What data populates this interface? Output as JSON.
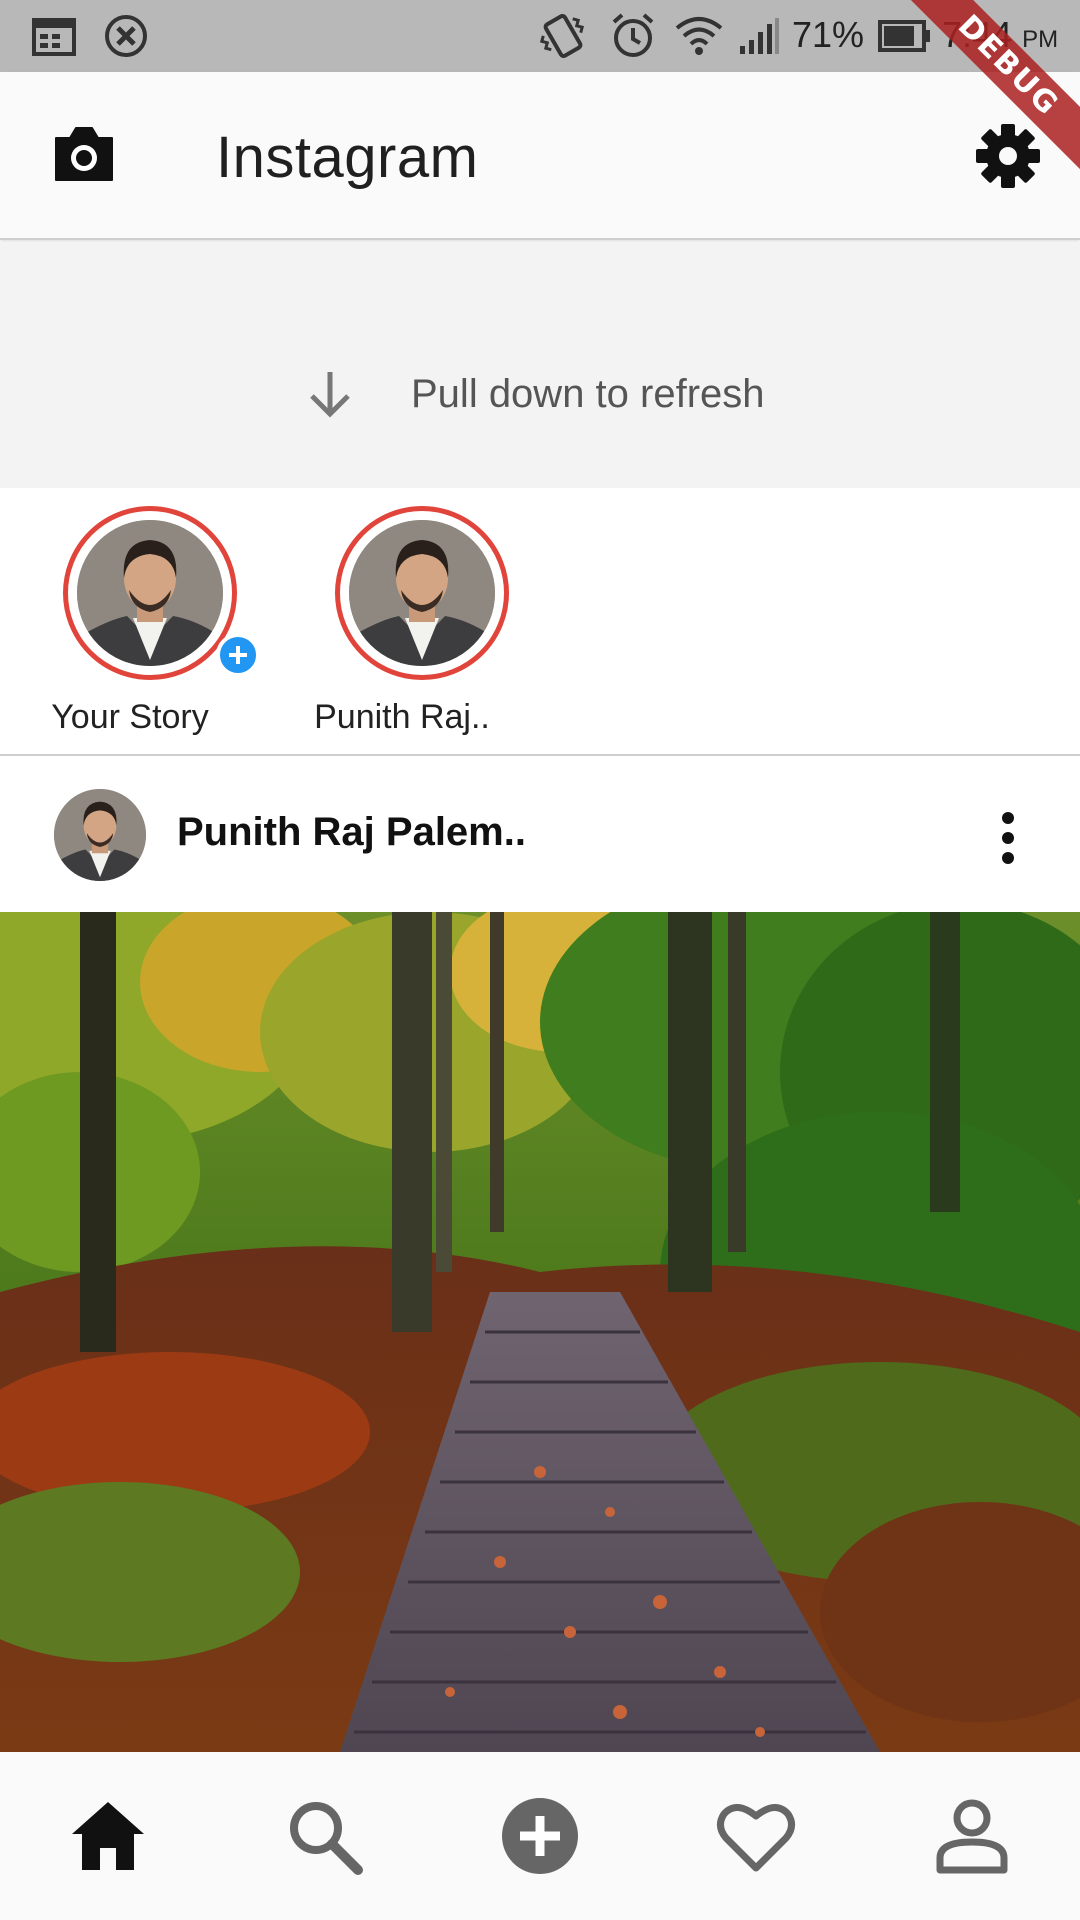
{
  "status_bar": {
    "battery": "71%",
    "time": "7:44",
    "ampm": "PM",
    "icons": [
      "calendar-icon",
      "close-circle-icon",
      "vibrate-icon",
      "alarm-icon",
      "wifi-icon",
      "signal-icon",
      "battery-icon"
    ]
  },
  "debug_banner": "DEBUG",
  "app_bar": {
    "title": "Instagram",
    "left_icon": "camera-icon",
    "right_icon": "settings-gear-icon"
  },
  "refresh": {
    "text": "Pull down to refresh",
    "icon": "arrow-down-icon"
  },
  "stories": [
    {
      "label": "Your Story",
      "has_add_badge": true
    },
    {
      "label": "Punith Raj..",
      "has_add_badge": false
    }
  ],
  "post": {
    "author": "Punith Raj Palem..",
    "menu_icon": "more-vert-icon",
    "image_description_icon": "forest-photo"
  },
  "bottom_nav": {
    "items": [
      "home-icon",
      "search-icon",
      "add-circle-icon",
      "heart-icon",
      "profile-icon"
    ],
    "active": "home-icon"
  },
  "colors": {
    "story_ring": "#e0443a",
    "add_badge": "#2196f3",
    "status_bar": "#b8b8b8",
    "app_bar": "#fafafa",
    "refresh_bg": "#f3f3f3"
  }
}
